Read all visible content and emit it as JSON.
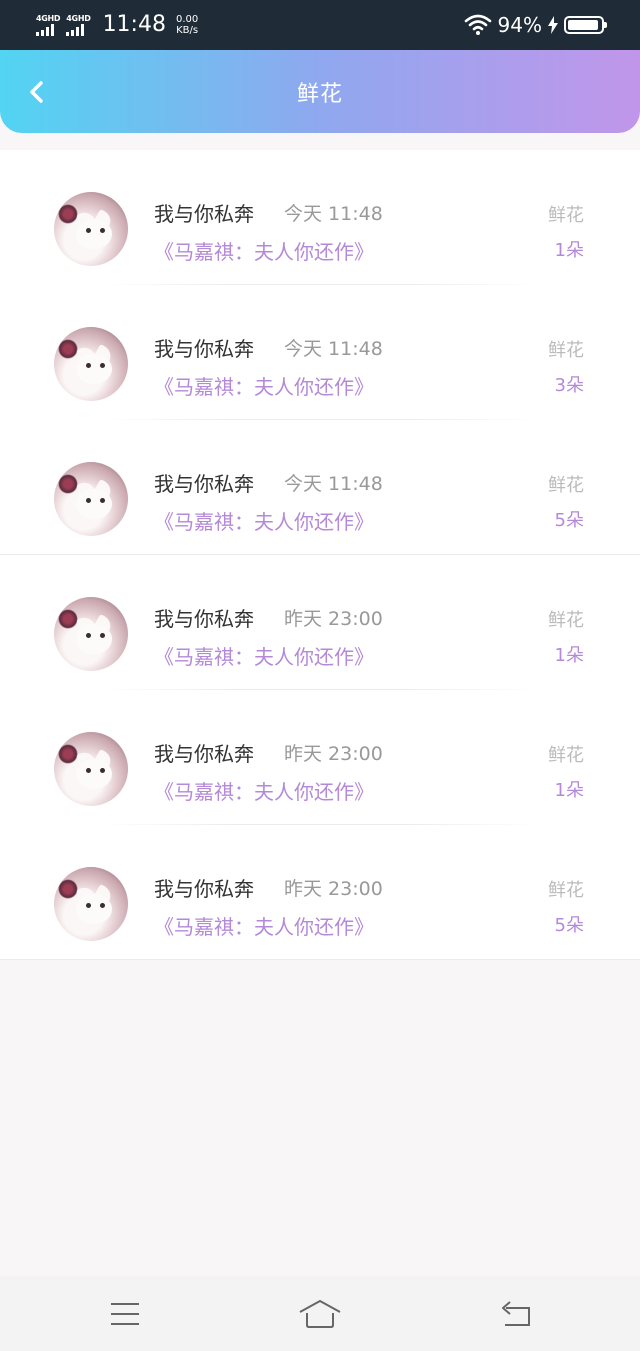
{
  "status": {
    "network1": "4GHD",
    "network2": "4GHD",
    "time": "11:48",
    "speed_value": "0.00",
    "speed_unit": "KB/s",
    "battery_pct": "94%",
    "battery_level": 0.94
  },
  "header": {
    "title": "鲜花",
    "back_icon": "chevron-left-icon"
  },
  "items": [
    {
      "name": "我与你私奔",
      "time": "今天 11:48",
      "book": "《马嘉祺：夫人你还作》",
      "flower_label": "鲜花",
      "count": "1朵"
    },
    {
      "name": "我与你私奔",
      "time": "今天 11:48",
      "book": "《马嘉祺：夫人你还作》",
      "flower_label": "鲜花",
      "count": "3朵"
    },
    {
      "name": "我与你私奔",
      "time": "今天 11:48",
      "book": "《马嘉祺：夫人你还作》",
      "flower_label": "鲜花",
      "count": "5朵"
    },
    {
      "name": "我与你私奔",
      "time": "昨天 23:00",
      "book": "《马嘉祺：夫人你还作》",
      "flower_label": "鲜花",
      "count": "1朵"
    },
    {
      "name": "我与你私奔",
      "time": "昨天 23:00",
      "book": "《马嘉祺：夫人你还作》",
      "flower_label": "鲜花",
      "count": "1朵"
    },
    {
      "name": "我与你私奔",
      "time": "昨天 23:00",
      "book": "《马嘉祺：夫人你还作》",
      "flower_label": "鲜花",
      "count": "5朵"
    }
  ],
  "colors": {
    "header_start": "#52d4f2",
    "header_end": "#c196ea",
    "accent_purple": "#b48ad8",
    "status_bg": "#1f2b36"
  },
  "navbar": {
    "menu_icon": "menu-icon",
    "home_icon": "home-icon",
    "back_icon": "back-arrow-icon"
  }
}
